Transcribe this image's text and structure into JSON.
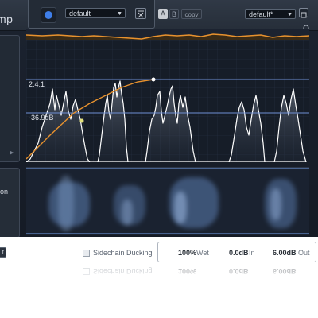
{
  "app": {
    "title_fragment": "mp"
  },
  "preset": {
    "selected": "default",
    "power_on": true
  },
  "ab": {
    "a_label": "A",
    "b_label": "B",
    "copy_label": "copy",
    "active": "A"
  },
  "right_preset": {
    "selected": "default*"
  },
  "graph": {
    "ratio_label": "2.4:1",
    "threshold_label": "-36.9dB"
  },
  "left_panel": {
    "label_line1": "on",
    "label_line2": ""
  },
  "bottom": {
    "left_button": "t",
    "sidechain_label": "Sidechain Ducking",
    "sidechain_checked": false,
    "wet_value": "100%",
    "wet_unit": "Wet",
    "in_value": "0.0dB",
    "in_unit": "In",
    "out_value": "6.00dB",
    "out_unit": "Out"
  },
  "colors": {
    "accent_orange": "#e8922e",
    "accent_blue": "#3f7ee8",
    "waveform_white": "#ffffff",
    "grid_line": "#6f8fd4"
  },
  "icons": {
    "power": "power-dot-icon",
    "random": "random-icon",
    "save": "save-icon",
    "headphones": "headphones-icon",
    "play": "play-triangle-icon"
  }
}
